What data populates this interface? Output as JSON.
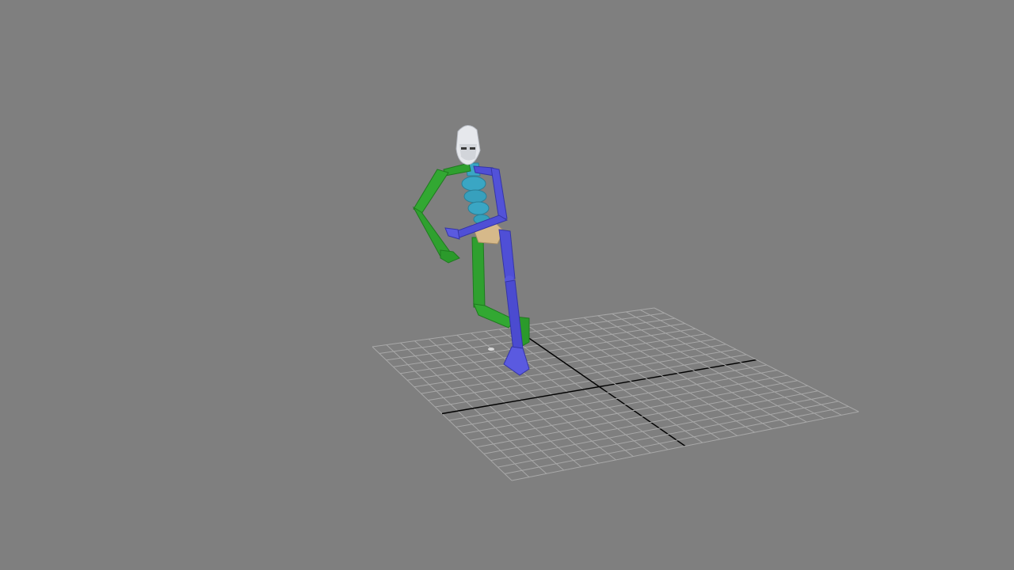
{
  "viewport": {
    "background": "#7f7f7f",
    "grid_line_color": "#a8a8a8",
    "grid_axis_color": "#000000"
  },
  "biped": {
    "colors": {
      "head": "#e6e8ec",
      "spine": "#3aa6c4",
      "left_side": "#2fa02f",
      "right_side": "#4f4fd6",
      "pelvis": "#d6b98a"
    }
  }
}
